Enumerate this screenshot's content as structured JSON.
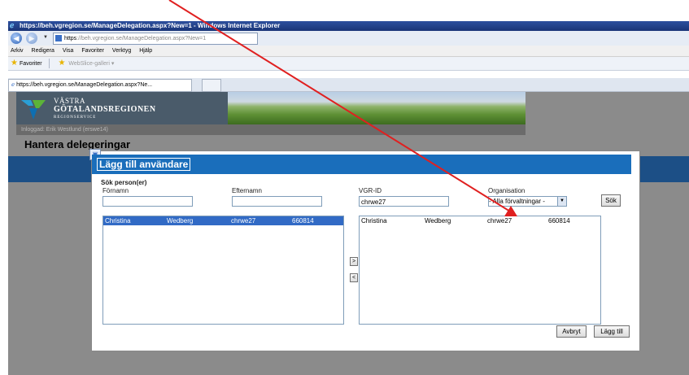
{
  "browser": {
    "window_title": "https://beh.vgregion.se/ManageDelegation.aspx?New=1 - Windows Internet Explorer",
    "url_bold": "https",
    "url_rest": "://beh.vgregion.se/ManageDelegation.aspx?New=1",
    "menu": [
      "Arkiv",
      "Redigera",
      "Visa",
      "Favoriter",
      "Verktyg",
      "Hjälp"
    ],
    "favorites_label": "Favoriter",
    "webslice_label": "WebSlice-galleri ▾",
    "tab_title": "https://beh.vgregion.se/ManageDelegation.aspx?Ne...",
    "back_glyph": "◀",
    "forward_glyph": "▶"
  },
  "page": {
    "logo_line1": "VÄSTRA",
    "logo_line2": "GÖTALANDSREGIONEN",
    "logo_line3": "REGIONSERVICE",
    "logged_in": "Inloggad: Erik Westlund (erswe14)",
    "title": "Hantera delegeringar",
    "brand_color": "#1a6ebb"
  },
  "dialog": {
    "title": "Lägg till användare",
    "search_heading": "Sök person(er)",
    "fields": {
      "firstname_label": "Förnamn",
      "firstname_value": "",
      "lastname_label": "Efternamn",
      "lastname_value": "",
      "vgrid_label": "VGR-ID",
      "vgrid_value": "chrwe27",
      "org_label": "Organisation",
      "org_value": "- Alla förvaltningar -"
    },
    "search_button": "Sök",
    "left_list": [
      {
        "firstname": "Christina",
        "lastname": "Wedberg",
        "vgrid": "chrwe27",
        "number": "660814",
        "selected": true
      }
    ],
    "right_list": [
      {
        "firstname": "Christina",
        "lastname": "Wedberg",
        "vgrid": "chrwe27",
        "number": "660814"
      }
    ],
    "move_right": ">",
    "move_left": "<",
    "cancel_button": "Avbryt",
    "add_button": "Lägg till"
  },
  "annotation": {
    "arrow_color": "#e02020"
  }
}
